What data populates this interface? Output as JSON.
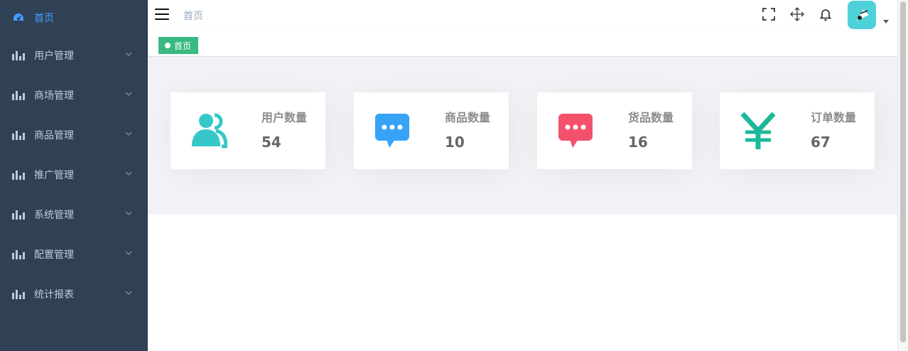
{
  "sidebar": {
    "items": [
      {
        "label": "首页",
        "icon": "dashboard-icon",
        "active": true
      },
      {
        "label": "用户管理",
        "icon": "chart-bars-icon"
      },
      {
        "label": "商场管理",
        "icon": "chart-bars-icon"
      },
      {
        "label": "商品管理",
        "icon": "chart-bars-icon"
      },
      {
        "label": "推广管理",
        "icon": "chart-bars-icon"
      },
      {
        "label": "系统管理",
        "icon": "chart-bars-icon"
      },
      {
        "label": "配置管理",
        "icon": "chart-bars-icon"
      },
      {
        "label": "统计报表",
        "icon": "chart-bars-icon"
      }
    ]
  },
  "header": {
    "breadcrumb": "首页",
    "icons": [
      "fullscreen-icon",
      "move-icon",
      "bell-icon"
    ]
  },
  "tags": [
    {
      "label": "首页"
    }
  ],
  "cards": [
    {
      "label": "用户数量",
      "value": "54",
      "icon": "users-icon",
      "color": "#36c7c9"
    },
    {
      "label": "商品数量",
      "value": "10",
      "icon": "message-icon",
      "color": "#36a3f7"
    },
    {
      "label": "货品数量",
      "value": "16",
      "icon": "message-icon",
      "color": "#f4516c"
    },
    {
      "label": "订单数量",
      "value": "67",
      "icon": "yen-icon",
      "color": "#1cb89a"
    }
  ],
  "colors": {
    "sidebar_bg": "#304156",
    "sidebar_text": "#bfcbd9",
    "active": "#409eff",
    "tag": "#3ab982",
    "main_bg": "#f0f2f5"
  }
}
